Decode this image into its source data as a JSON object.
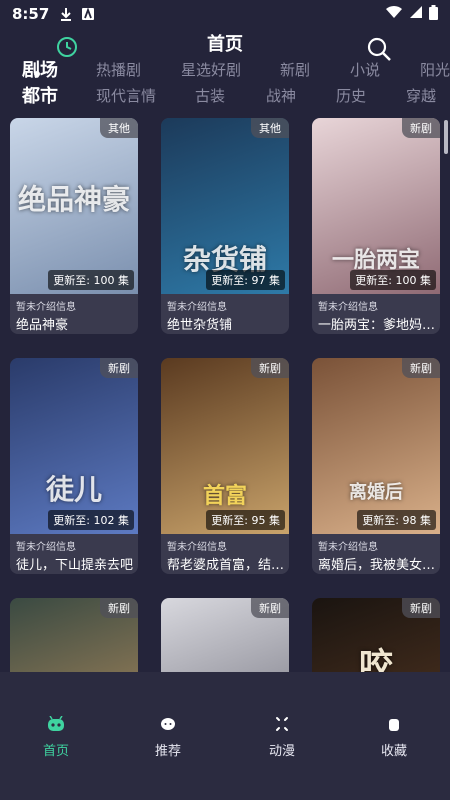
{
  "statusbar": {
    "time": "8:57"
  },
  "header": {
    "title": "首页"
  },
  "categories_row1": [
    "剧场",
    "热播剧",
    "星选好剧",
    "新剧",
    "小说",
    "阳光"
  ],
  "categories_row2": [
    "都市",
    "现代言情",
    "古装",
    "战神",
    "历史",
    "穿越"
  ],
  "cards": [
    {
      "badge": "其他",
      "update": "更新至: 100 集",
      "info": "暂未介绍信息",
      "name": "绝品神豪",
      "art": "绝品神豪",
      "color1": "#c9d6e8",
      "color2": "#7a8fae"
    },
    {
      "badge": "其他",
      "update": "更新至: 97 集",
      "info": "暂未介绍信息",
      "name": "绝世杂货铺",
      "art": "杂货铺",
      "color1": "#1c3a5a",
      "color2": "#2e7aa8"
    },
    {
      "badge": "新剧",
      "update": "更新至: 100 集",
      "info": "暂未介绍信息",
      "name": "一胎两宝：爹地妈咪…",
      "art": "一胎两宝",
      "color1": "#e8d5d8",
      "color2": "#8f6a74"
    },
    {
      "badge": "新剧",
      "update": "更新至: 102 集",
      "info": "暂未介绍信息",
      "name": "徒儿，下山提亲去吧",
      "art": "徒儿",
      "color1": "#2a3b6a",
      "color2": "#5d7ac2"
    },
    {
      "badge": "新剧",
      "update": "更新至: 95 集",
      "info": "暂未介绍信息",
      "name": "帮老婆成首富，结果…",
      "art": "首富",
      "color1": "#5a3a20",
      "color2": "#c9a36b"
    },
    {
      "badge": "新剧",
      "update": "更新至: 98 集",
      "info": "暂未介绍信息",
      "name": "离婚后，我被美女包…",
      "art": "离婚后",
      "color1": "#7a5238",
      "color2": "#d9b08a"
    },
    {
      "badge": "新剧",
      "update": "",
      "info": "",
      "name": "",
      "art": "",
      "color1": "#3a4a42",
      "color2": "#b89060"
    },
    {
      "badge": "新剧",
      "update": "",
      "info": "",
      "name": "",
      "art": "",
      "color1": "#d8d8de",
      "color2": "#6a6a76"
    },
    {
      "badge": "新剧",
      "update": "",
      "info": "",
      "name": "",
      "art": "咬",
      "color1": "#1a1410",
      "color2": "#5a3a24"
    }
  ],
  "nav": [
    {
      "label": "首页",
      "icon": "home-icon"
    },
    {
      "label": "推荐",
      "icon": "recommend-icon"
    },
    {
      "label": "动漫",
      "icon": "anime-icon"
    },
    {
      "label": "收藏",
      "icon": "favorite-icon"
    }
  ],
  "colors": {
    "accent": "#3fd3a0",
    "background": "#24243a",
    "nav_background": "#2b2b40"
  }
}
